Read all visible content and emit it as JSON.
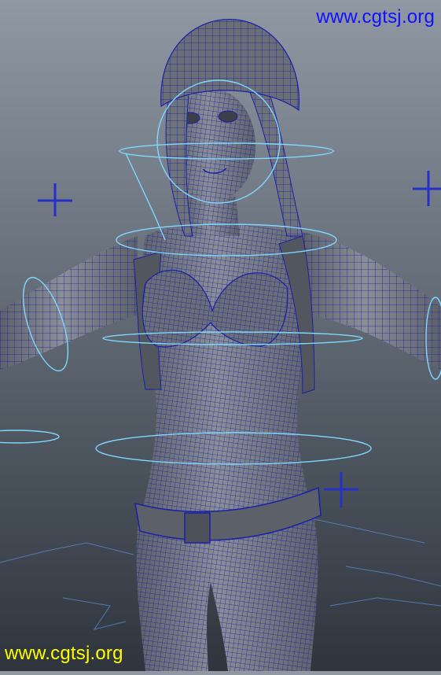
{
  "watermarks": {
    "top": "www.cgtsj.org",
    "bottom": "www.cgtsj.org"
  },
  "colors": {
    "background_top": "#8f98a3",
    "background_bottom": "#2f353d",
    "mesh_fill": "#7c8088",
    "mesh_shade": "#5d6169",
    "wireframe": "#1a20a8",
    "rig_control": "#7fd7ff",
    "watermark_top": "#1010ff",
    "watermark_bottom": "#ffff00"
  },
  "scene": {
    "subject": "wireframe-character-model",
    "rig_controls": [
      "head-ring",
      "neck-ring",
      "chest-ring",
      "waist-ring",
      "shoulder-ring-left",
      "shoulder-ring-right",
      "wrist-ring-left",
      "wrist-ring-right",
      "pole-vector-left",
      "pole-vector-right",
      "pole-vector-hip"
    ]
  }
}
